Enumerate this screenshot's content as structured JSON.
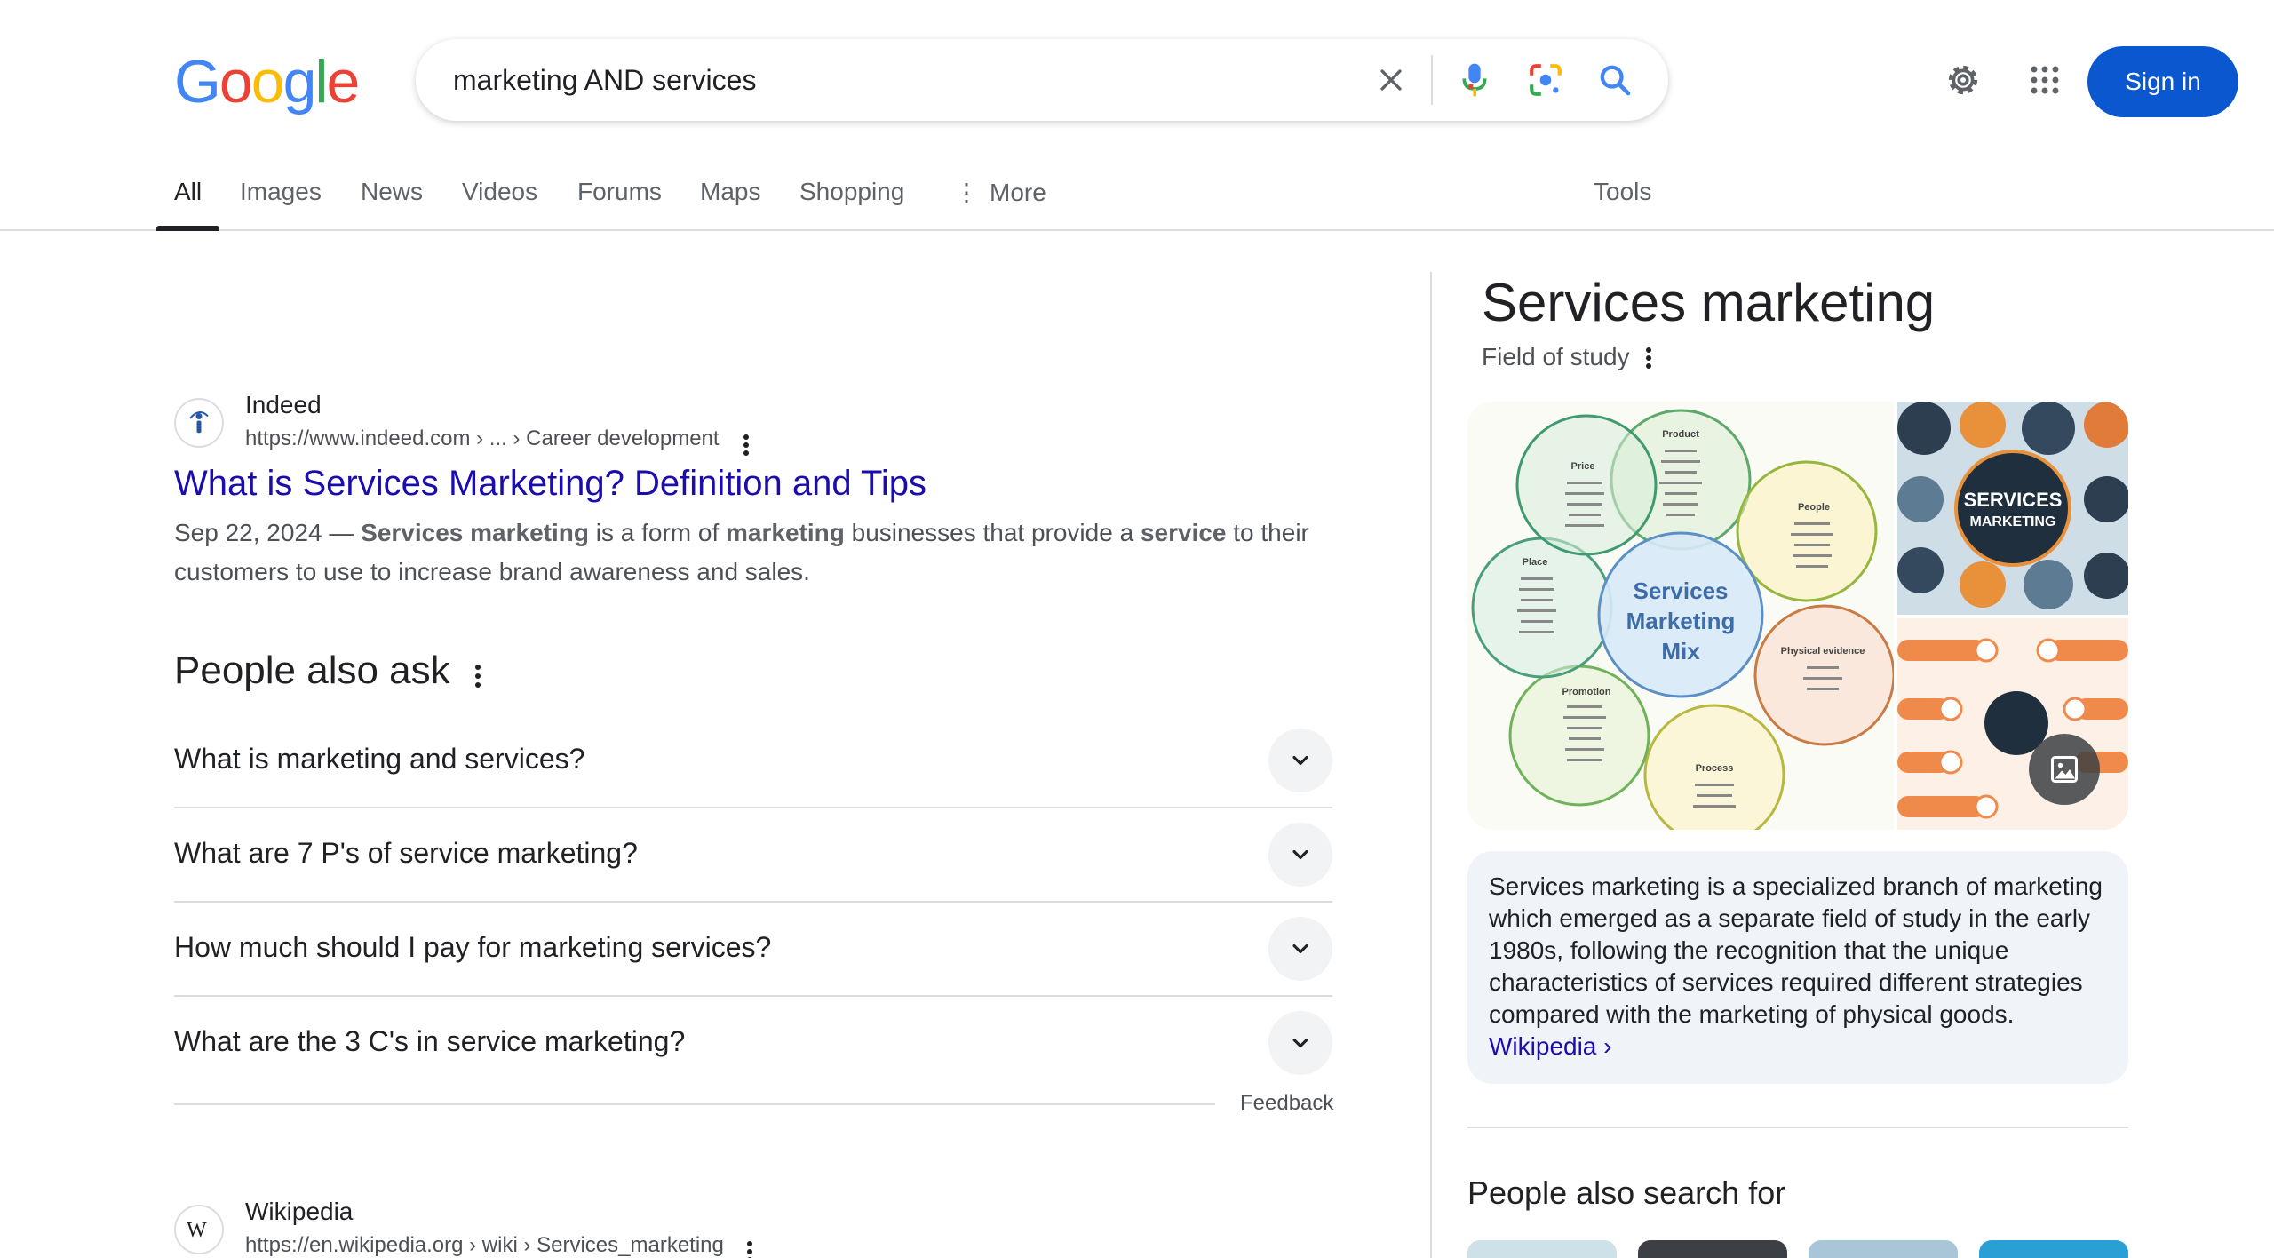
{
  "logo": {
    "letters": [
      {
        "char": "G",
        "color": "#4285f4"
      },
      {
        "char": "o",
        "color": "#ea4335"
      },
      {
        "char": "o",
        "color": "#fbbc05"
      },
      {
        "char": "g",
        "color": "#4285f4"
      },
      {
        "char": "l",
        "color": "#34a853"
      },
      {
        "char": "e",
        "color": "#ea4335"
      }
    ]
  },
  "search": {
    "query": "marketing AND services",
    "icons": [
      "close-icon",
      "mic-icon",
      "lens-icon",
      "search-icon"
    ]
  },
  "header": {
    "icons": [
      "gear-icon",
      "apps-grid-icon"
    ],
    "sign_in": "Sign in"
  },
  "tabs": {
    "items": [
      {
        "label": "All",
        "active": true
      },
      {
        "label": "Images"
      },
      {
        "label": "News"
      },
      {
        "label": "Videos"
      },
      {
        "label": "Forums"
      },
      {
        "label": "Maps"
      },
      {
        "label": "Shopping"
      },
      {
        "label": "More"
      }
    ],
    "tools": "Tools"
  },
  "results": [
    {
      "site": "Indeed",
      "url": "https://www.indeed.com › ... › Career development",
      "title": "What is Services Marketing? Definition and Tips",
      "snippet": {
        "date": "Sep 22, 2024",
        "dash": " — ",
        "b1": "Services marketing",
        "t1": " is a form of ",
        "b2": "marketing",
        "t2": " businesses that provide a ",
        "b3": "service",
        "t3": " to their customers to use to increase brand awareness and sales."
      }
    },
    {
      "site": "Wikipedia",
      "url": "https://en.wikipedia.org › wiki › Services_marketing"
    }
  ],
  "people_also_ask": {
    "title": "People also ask",
    "questions": [
      "What is marketing and services?",
      "What are 7 P's of service marketing?",
      "How much should I pay for marketing services?",
      "What are the 3 C's in service marketing?"
    ],
    "feedback": "Feedback"
  },
  "knowledge_panel": {
    "title": "Services marketing",
    "subtitle": "Field of study",
    "images": {
      "mix_diagram": {
        "center": [
          "Services",
          "Marketing",
          "Mix"
        ],
        "petals": [
          "Product",
          "People",
          "Physical evidence",
          "Process",
          "Promotion",
          "Place",
          "Price"
        ]
      },
      "poster_text": [
        "SERVICES",
        "MARKETING"
      ]
    },
    "description": "Services marketing is a specialized branch of marketing which emerged as a separate field of study in the early 1980s, following the recognition that the unique characteristics of services required different strategies compared with the marketing of physical goods. ",
    "source_link": "Wikipedia ›",
    "people_also_search_for": "People also search for"
  },
  "colors": {
    "link": "#1a0dab",
    "accent": "#0b57d0",
    "text": "#202124",
    "muted": "#4d5156"
  }
}
